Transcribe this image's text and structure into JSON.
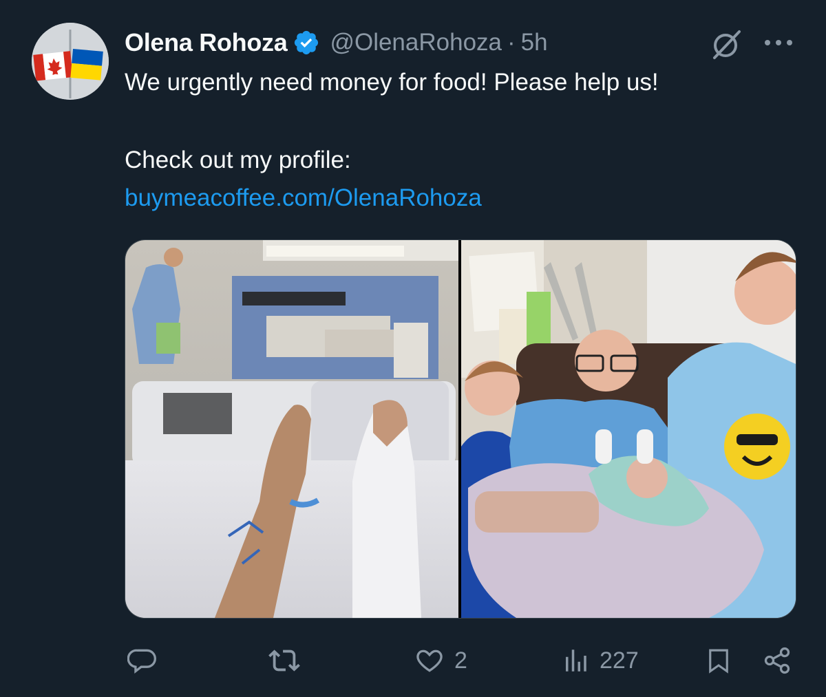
{
  "author": {
    "name": "Olena Rohoza",
    "handle": "@OlenaRohoza",
    "separator": "·",
    "time": "5h",
    "verified": true,
    "avatar": "canada-ukraine-flags-avatar"
  },
  "post": {
    "line1": "We urgently need money for food! Please help us!",
    "line2": "Check out my profile:",
    "link": "buymeacoffee.com/OlenaRohoza"
  },
  "media": [
    {
      "name": "hospital-bed-photo",
      "icon": "photo"
    },
    {
      "name": "family-photo",
      "icon": "photo"
    }
  ],
  "actions": {
    "reply": {
      "icon": "reply-icon",
      "count": ""
    },
    "repost": {
      "icon": "repost-icon",
      "count": ""
    },
    "like": {
      "icon": "heart-icon",
      "count": "2"
    },
    "views": {
      "icon": "views-icon",
      "count": "227"
    },
    "bookmark": {
      "icon": "bookmark-icon"
    },
    "share": {
      "icon": "share-icon"
    }
  },
  "colors": {
    "background": "#15202b",
    "text": "#f7f9f9",
    "muted": "#8b98a5",
    "link": "#1d9bf0",
    "verified": "#1d9bf0"
  }
}
